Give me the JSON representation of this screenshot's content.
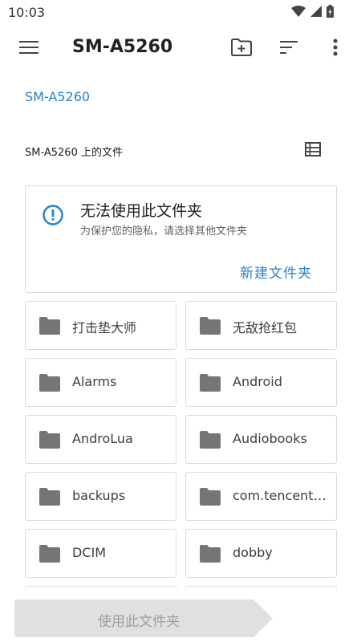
{
  "status_bar": {
    "time": "10:03",
    "icons": [
      "wifi-icon",
      "signal-icon",
      "battery-icon"
    ]
  },
  "app_bar": {
    "title": "SM-A5260",
    "icons": [
      "menu-icon",
      "new-folder-icon",
      "sort-icon",
      "more-vert-icon"
    ]
  },
  "breadcrumb": {
    "root": "SM-A5260"
  },
  "section": {
    "title": "SM-A5260 上的文件"
  },
  "notice": {
    "title": "无法使用此文件夹",
    "subtitle": "为保护您的隐私，请选择其他文件夹",
    "action": "新建文件夹"
  },
  "folders": [
    {
      "name": "打击垫大师"
    },
    {
      "name": "无敌抢红包"
    },
    {
      "name": "Alarms"
    },
    {
      "name": "Android"
    },
    {
      "name": "AndroLua"
    },
    {
      "name": "Audiobooks"
    },
    {
      "name": "backups"
    },
    {
      "name": "com.tencent...."
    },
    {
      "name": "DCIM"
    },
    {
      "name": "dobby"
    }
  ],
  "bottom": {
    "use_folder_label": "使用此文件夹"
  },
  "colors": {
    "accent": "#2a82c9",
    "folder_icon": "#757575",
    "disabled_button": "#e0e0e0",
    "border": "#dadce0"
  }
}
